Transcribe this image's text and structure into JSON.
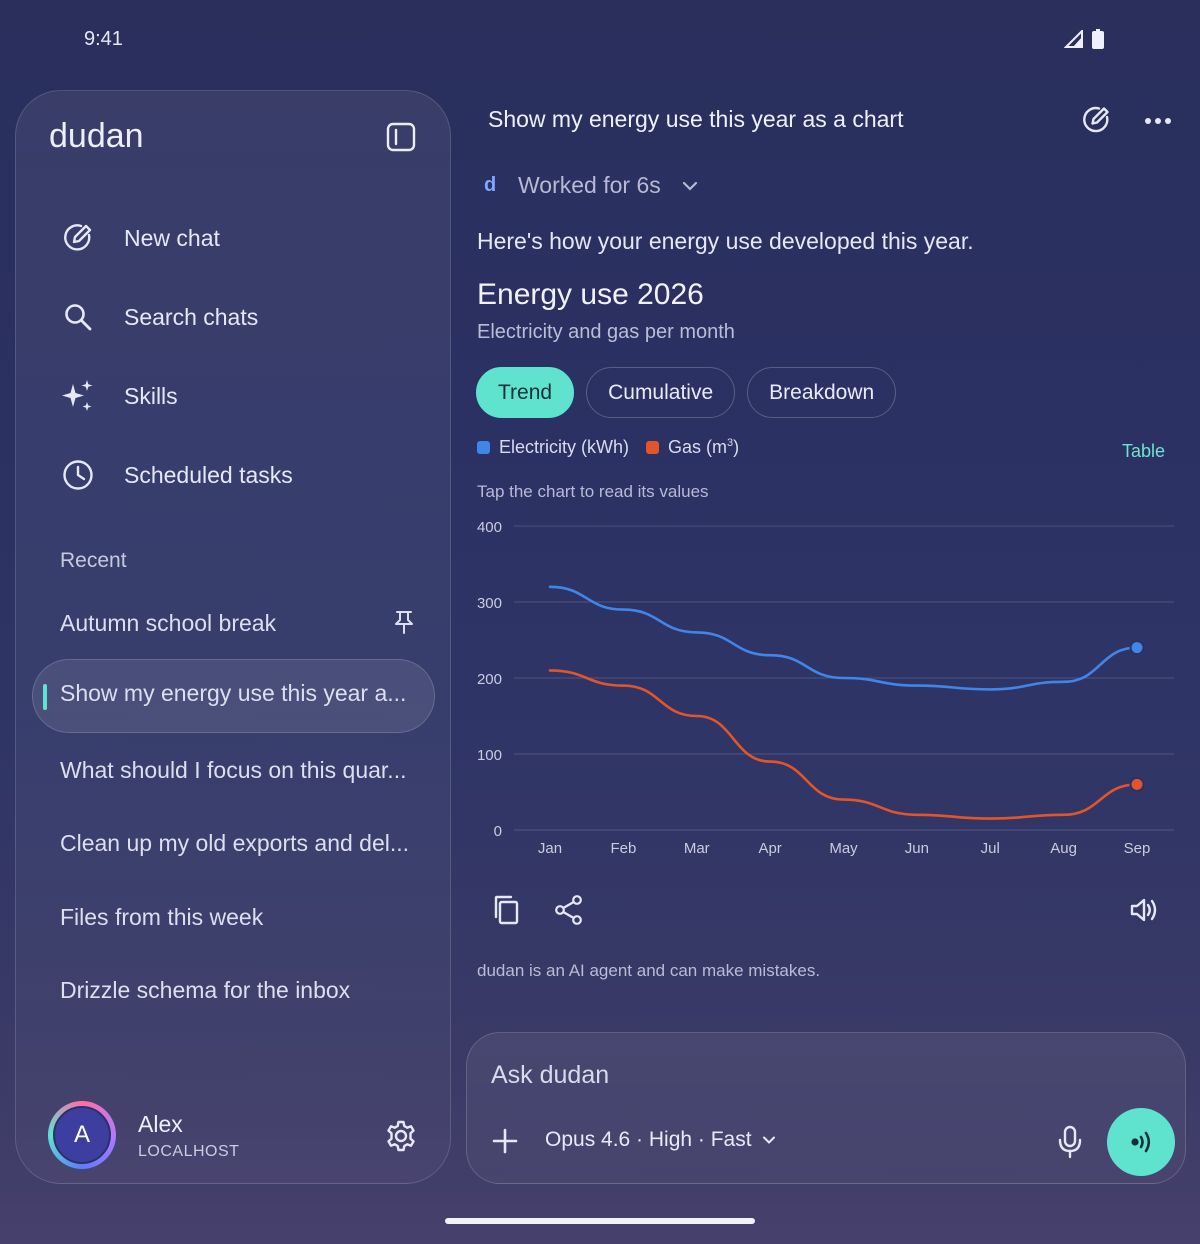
{
  "status": {
    "time": "9:41"
  },
  "sidebar": {
    "brand": "dudan",
    "nav": [
      {
        "label": "New chat",
        "icon": "edit-icon"
      },
      {
        "label": "Search chats",
        "icon": "search-icon"
      },
      {
        "label": "Skills",
        "icon": "sparkle-icon"
      },
      {
        "label": "Scheduled tasks",
        "icon": "clock-icon"
      }
    ],
    "recent_heading": "Recent",
    "recent": [
      "Autumn school break",
      "Show my energy use this year a...",
      "What should I focus on this quar...",
      "Clean up my old exports and del...",
      "Files from this week",
      "Drizzle schema for the inbox"
    ],
    "user": {
      "initial": "A",
      "name": "Alex",
      "host": "LOCALHOST"
    }
  },
  "main": {
    "title": "Show my energy use this year as a chart",
    "worked": "Worked for 6s",
    "worked_icon": "d",
    "intro": "Here's how your energy use developed this year.",
    "chart_title": "Energy use 2026",
    "chart_subtitle": "Electricity and gas per month",
    "tabs": [
      "Trend",
      "Cumulative",
      "Breakdown"
    ],
    "legend_electricity": "Electricity (kWh)",
    "legend_gas": "Gas (m",
    "legend_gas_sup": "3",
    "legend_gas_end": ")",
    "table_link": "Table",
    "hint": "Tap the chart to read its values",
    "disclaimer": "dudan is an AI agent and can make mistakes."
  },
  "composer": {
    "placeholder": "Ask dudan",
    "model": "Opus 4.6 · High · Fast"
  },
  "colors": {
    "accent": "#5fe3cf",
    "electricity": "#3f86e8",
    "gas": "#e0562a"
  },
  "chart_data": {
    "type": "line",
    "categories": [
      "Jan",
      "Feb",
      "Mar",
      "Apr",
      "May",
      "Jun",
      "Jul",
      "Aug",
      "Sep"
    ],
    "series": [
      {
        "name": "Electricity (kWh)",
        "values": [
          320,
          290,
          260,
          230,
          200,
          190,
          185,
          195,
          240
        ]
      },
      {
        "name": "Gas (m³)",
        "values": [
          210,
          190,
          150,
          90,
          40,
          20,
          15,
          20,
          60
        ]
      }
    ],
    "ylim": [
      0,
      400
    ],
    "yticks": [
      0,
      100,
      200,
      300,
      400
    ],
    "grid": true,
    "legend": "top-left"
  }
}
